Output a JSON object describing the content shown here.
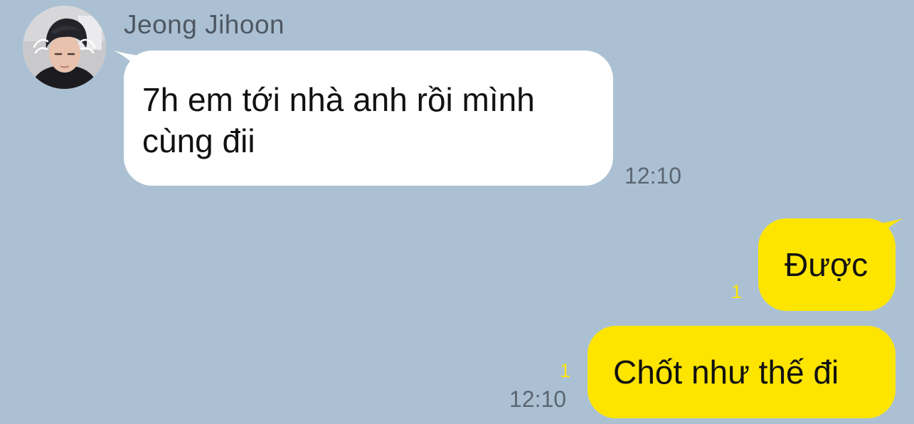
{
  "incoming": {
    "sender_name": "Jeong Jihoon",
    "avatar_icon": "profile-photo-avatar",
    "message": "7h em tới nhà anh rồi mình cùng đii",
    "time": "12:10",
    "bubble_color": "#ffffff"
  },
  "outgoing": [
    {
      "message": "Được",
      "unread_count": "1"
    },
    {
      "message": "Chốt như thế đi",
      "unread_count": "1",
      "time": "12:10"
    }
  ],
  "colors": {
    "background": "#abc1d3",
    "outgoing_bubble": "#fee500",
    "unread_count": "#fee500",
    "timestamp": "#5b6672",
    "sender_name": "#4e5762"
  }
}
